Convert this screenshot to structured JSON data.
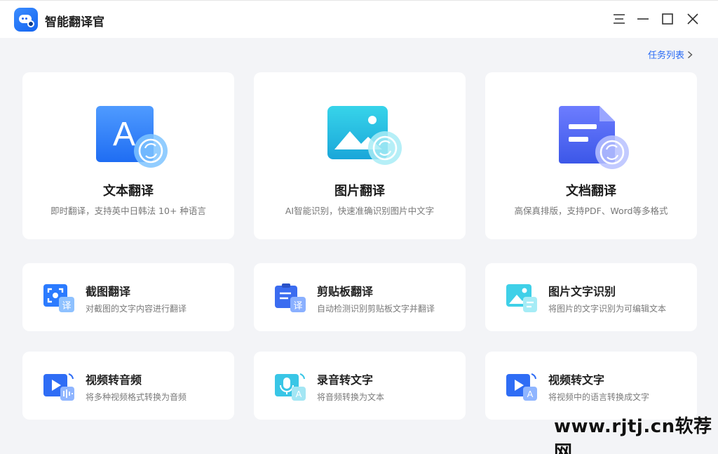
{
  "app": {
    "title": "智能翻译官"
  },
  "header": {
    "task_list": "任务列表"
  },
  "big_cards": [
    {
      "title": "文本翻译",
      "desc": "即时翻译，支持英中日韩法 10+ 种语言",
      "icon": "text-translate-icon",
      "letter": "A"
    },
    {
      "title": "图片翻译",
      "desc": "AI智能识别，快速准确识别图片中文字",
      "icon": "image-translate-icon"
    },
    {
      "title": "文档翻译",
      "desc": "高保真排版，支持PDF、Word等多格式",
      "icon": "document-translate-icon"
    }
  ],
  "small_cards": [
    {
      "title": "截图翻译",
      "desc": "对截图的文字内容进行翻译",
      "icon": "screenshot-translate-icon",
      "badge": "译"
    },
    {
      "title": "剪贴板翻译",
      "desc": "自动检测识别剪贴板文字并翻译",
      "icon": "clipboard-translate-icon",
      "badge": "译"
    },
    {
      "title": "图片文字识别",
      "desc": "将图片的文字识别为可编辑文本",
      "icon": "image-ocr-icon"
    },
    {
      "title": "视频转音频",
      "desc": "将多种视频格式转换为音频",
      "icon": "video-to-audio-icon"
    },
    {
      "title": "录音转文字",
      "desc": "将音频转换为文本",
      "icon": "audio-to-text-icon",
      "badge": "A"
    },
    {
      "title": "视频转文字",
      "desc": "将视频中的语言转换成文字",
      "icon": "video-to-text-icon",
      "badge": "A"
    }
  ],
  "watermark": "www.rjtj.cn软荐网",
  "colors": {
    "accent": "#2b6cf5",
    "background": "#f3f4f7",
    "card": "#ffffff"
  }
}
